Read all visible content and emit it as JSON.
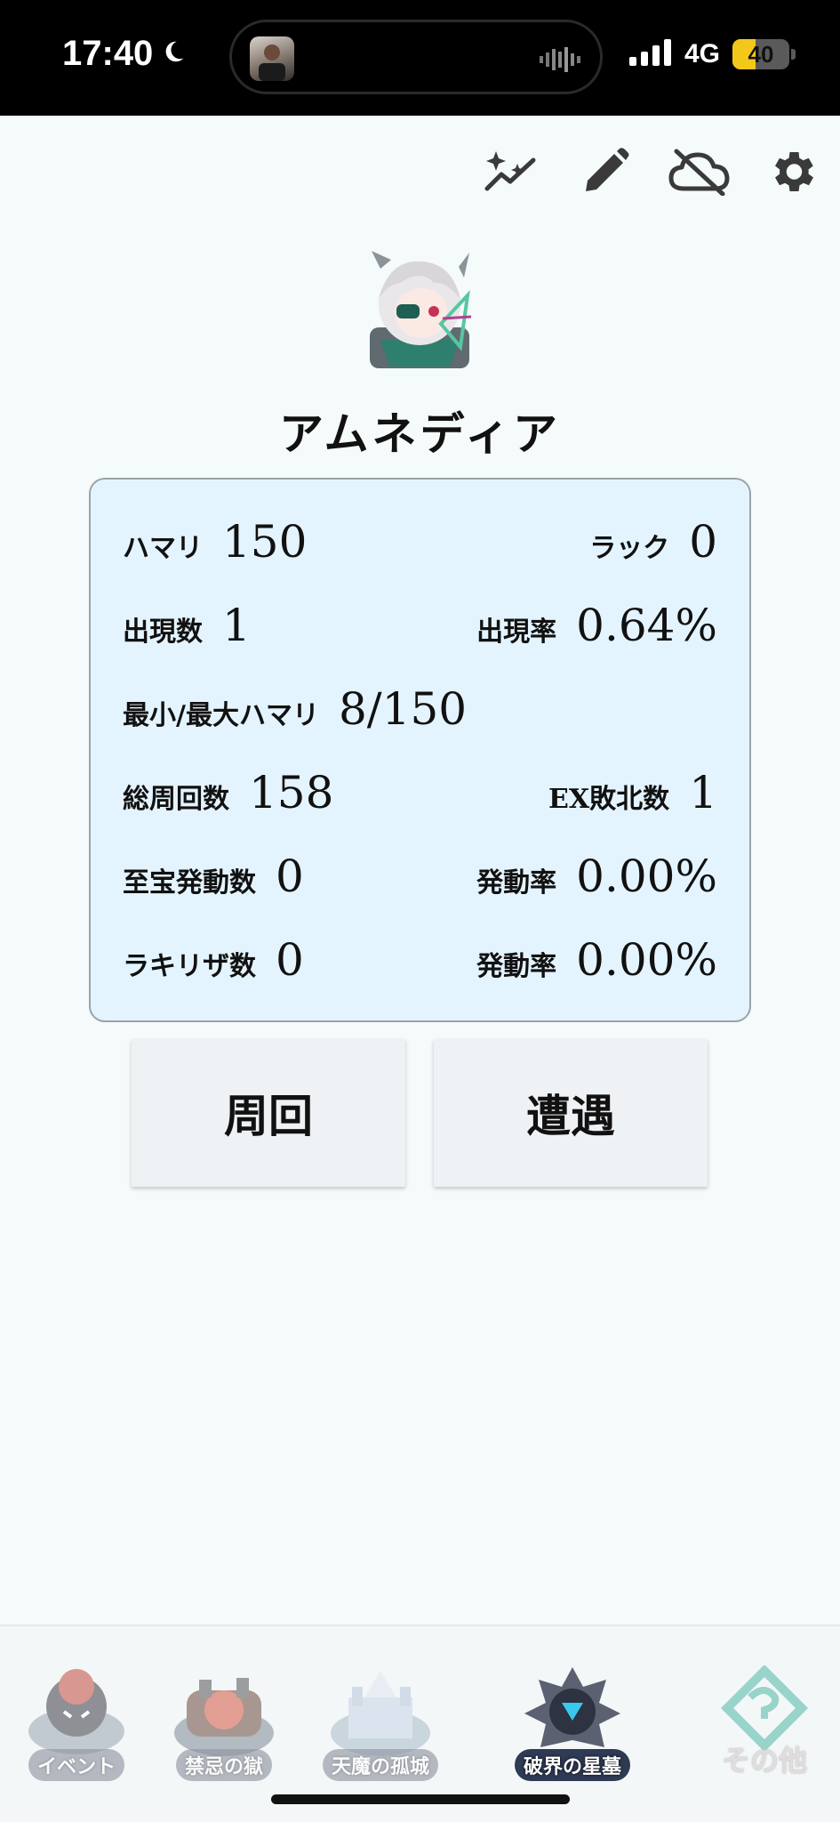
{
  "status_bar": {
    "time": "17:40",
    "network": "4G",
    "battery": "40",
    "battery_level": 0.4
  },
  "toolbar": {
    "icons": [
      "sparkle-chart-icon",
      "pencil-icon",
      "cloud-off-icon",
      "gear-icon"
    ]
  },
  "character": {
    "name": "アムネディア"
  },
  "stats": {
    "hamari_label": "ハマリ",
    "hamari_value": "150",
    "luck_label": "ラック",
    "luck_value": "0",
    "appear_count_label": "出現数",
    "appear_count_value": "1",
    "appear_rate_label": "出現率",
    "appear_rate_value": "0.64%",
    "minmax_label": "最小/最大ハマリ",
    "minmax_value": "8/150",
    "total_laps_label": "総周回数",
    "total_laps_value": "158",
    "ex_defeat_label": "EX敗北数",
    "ex_defeat_value": "1",
    "treasure_label": "至宝発動数",
    "treasure_value": "0",
    "treasure_rate_label": "発動率",
    "treasure_rate_value": "0.00%",
    "rakiriza_label": "ラキリザ数",
    "rakiriza_value": "0",
    "rakiriza_rate_label": "発動率",
    "rakiriza_rate_value": "0.00%"
  },
  "actions": {
    "shuukai_label": "周回",
    "sougu_label": "遭遇"
  },
  "bottom_nav": {
    "items": [
      {
        "label": "イベント",
        "active": false
      },
      {
        "label": "禁忌の獄",
        "active": false
      },
      {
        "label": "天魔の孤城",
        "active": false
      },
      {
        "label": "破界の星墓",
        "active": true
      },
      {
        "label": "その他",
        "active": false
      }
    ]
  },
  "colors": {
    "card_bg": "#e4f4fe",
    "page_bg": "#f5fafb",
    "battery_yellow": "#f4c81b"
  }
}
